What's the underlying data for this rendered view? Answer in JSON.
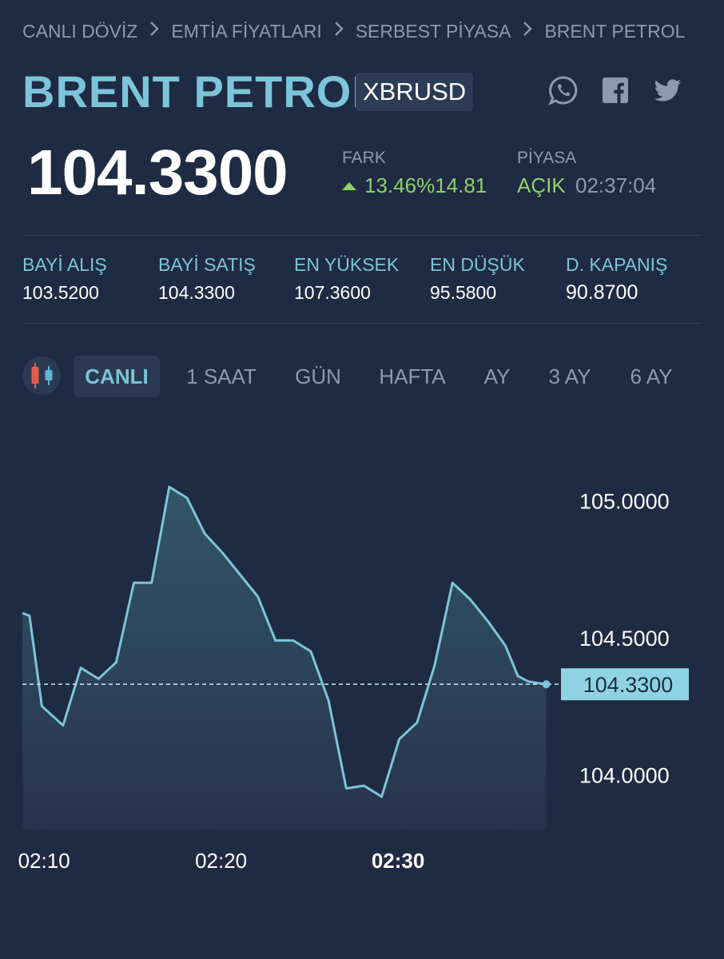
{
  "breadcrumb": [
    "CANLI DÖVİZ",
    "EMTİA FİYATLARI",
    "SERBEST PİYASA",
    "BRENT PETROL"
  ],
  "title": "BRENT PETROL",
  "ticker": "XBRUSD",
  "social": [
    "whatsapp-icon",
    "facebook-icon",
    "twitter-icon"
  ],
  "price": "104.3300",
  "change": {
    "label": "FARK",
    "direction": "up",
    "percent": "13.46%",
    "amount": "14.81",
    "color": "#8fd16a"
  },
  "market": {
    "label": "PİYASA",
    "status": "AÇIK",
    "time": "02:37:04"
  },
  "stats": [
    {
      "label": "BAYİ ALIŞ",
      "value": "103.5200"
    },
    {
      "label": "BAYİ SATIŞ",
      "value": "104.3300"
    },
    {
      "label": "EN YÜKSEK",
      "value": "107.3600"
    },
    {
      "label": "EN DÜŞÜK",
      "value": "95.5800"
    },
    {
      "label": "D. KAPANIŞ",
      "value": "90.8700"
    }
  ],
  "tabs": [
    "CANLI",
    "1 SAAT",
    "GÜN",
    "HAFTA",
    "AY",
    "3 AY",
    "6 AY"
  ],
  "active_tab": "CANLI",
  "colors": {
    "background": "#1f2b42",
    "accent": "#7cc4d9",
    "positive": "#8fd16a",
    "muted": "#8c9ab0"
  },
  "chart_data": {
    "type": "area",
    "x_ticks": [
      "02:10",
      "02:20",
      "02:30"
    ],
    "x_tick_minutes": [
      10,
      20,
      30
    ],
    "highlighted_x_tick": "02:30",
    "y_ticks": [
      "105.0000",
      "104.5000",
      "104.0000"
    ],
    "y_tick_values": [
      105.0,
      104.5,
      104.0
    ],
    "current_value_label": "104.3300",
    "current_value": 104.33,
    "ylim": [
      103.8,
      105.15
    ],
    "xlim": [
      9.0,
      38.8
    ],
    "points": [
      {
        "t": 9.0,
        "v": 104.59
      },
      {
        "t": 9.4,
        "v": 104.58
      },
      {
        "t": 10.1,
        "v": 104.25
      },
      {
        "t": 11.3,
        "v": 104.18
      },
      {
        "t": 12.3,
        "v": 104.39
      },
      {
        "t": 13.3,
        "v": 104.35
      },
      {
        "t": 14.3,
        "v": 104.41
      },
      {
        "t": 15.3,
        "v": 104.7
      },
      {
        "t": 16.3,
        "v": 104.7
      },
      {
        "t": 17.3,
        "v": 105.05
      },
      {
        "t": 18.3,
        "v": 105.01
      },
      {
        "t": 19.3,
        "v": 104.88
      },
      {
        "t": 20.3,
        "v": 104.81
      },
      {
        "t": 21.3,
        "v": 104.73
      },
      {
        "t": 22.3,
        "v": 104.65
      },
      {
        "t": 23.3,
        "v": 104.49
      },
      {
        "t": 24.3,
        "v": 104.49
      },
      {
        "t": 25.3,
        "v": 104.45
      },
      {
        "t": 26.3,
        "v": 104.27
      },
      {
        "t": 27.3,
        "v": 103.95
      },
      {
        "t": 28.3,
        "v": 103.96
      },
      {
        "t": 29.3,
        "v": 103.92
      },
      {
        "t": 30.3,
        "v": 104.13
      },
      {
        "t": 31.3,
        "v": 104.19
      },
      {
        "t": 32.3,
        "v": 104.4
      },
      {
        "t": 33.3,
        "v": 104.7
      },
      {
        "t": 34.3,
        "v": 104.64
      },
      {
        "t": 35.3,
        "v": 104.56
      },
      {
        "t": 36.3,
        "v": 104.47
      },
      {
        "t": 37.0,
        "v": 104.36
      },
      {
        "t": 37.6,
        "v": 104.34
      },
      {
        "t": 38.6,
        "v": 104.33
      }
    ]
  }
}
